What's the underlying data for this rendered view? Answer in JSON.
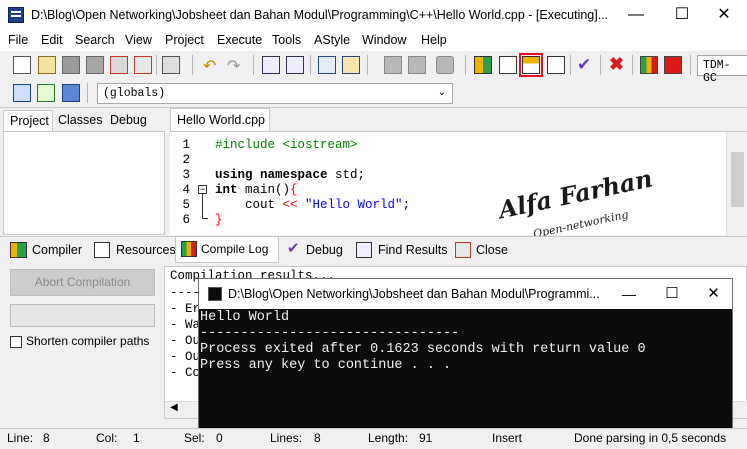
{
  "window": {
    "title": "D:\\Blog\\Open Networking\\Jobsheet dan Bahan Modul\\Programming\\C++\\Hello World.cpp - [Executing]...",
    "minimize_glyph": "—",
    "maximize_glyph": "☐",
    "close_glyph": "✕"
  },
  "menu": [
    "File",
    "Edit",
    "Search",
    "View",
    "Project",
    "Execute",
    "Tools",
    "AStyle",
    "Window",
    "Help"
  ],
  "toolbar": {
    "compiler_combo": "TDM-GC",
    "scope_combo": "(globals)"
  },
  "left_tabs": [
    "Project",
    "Classes",
    "Debug"
  ],
  "editor": {
    "tab": "Hello World.cpp",
    "line_numbers": [
      "1",
      "2",
      "3",
      "4",
      "5",
      "6"
    ],
    "lines": [
      {
        "parts": [
          {
            "t": "#include <iostream>",
            "c": "pp"
          }
        ]
      },
      {
        "parts": []
      },
      {
        "parts": [
          {
            "t": "using namespace",
            "c": "kw"
          },
          {
            "t": " std;",
            "c": ""
          }
        ]
      },
      {
        "parts": [
          {
            "t": "int",
            "c": "kw"
          },
          {
            "t": " main()",
            "c": ""
          },
          {
            "t": "{",
            "c": "br"
          }
        ]
      },
      {
        "parts": [
          {
            "t": "    cout ",
            "c": ""
          },
          {
            "t": "<<",
            "c": "op"
          },
          {
            "t": " ",
            "c": ""
          },
          {
            "t": "\"Hello World\"",
            "c": "str"
          },
          {
            "t": ";",
            "c": ""
          }
        ]
      },
      {
        "parts": [
          {
            "t": "}",
            "c": "br"
          }
        ]
      }
    ],
    "fold_marker": "−"
  },
  "watermark": {
    "line1": "Alfa Farhan",
    "line2": "Open-networking"
  },
  "bottom_tabs": [
    "Compiler",
    "Resources",
    "Compile Log",
    "Debug",
    "Find Results",
    "Close"
  ],
  "compile_panel": {
    "abort_button": "Abort Compilation",
    "shorten_label": "Shorten compiler paths",
    "log_header": "Compilation results...",
    "log_lines": [
      "----",
      "- Er",
      "- Wa",
      "- Ou",
      "- Ou",
      "- Co"
    ]
  },
  "console": {
    "title": "D:\\Blog\\Open Networking\\Jobsheet dan Bahan Modul\\Programmi...",
    "lines": [
      "Hello World",
      "--------------------------------",
      "Process exited after 0.1623 seconds with return value 0",
      "Press any key to continue . . ."
    ]
  },
  "statusbar": {
    "line_label": "Line:",
    "line_value": "8",
    "col_label": "Col:",
    "col_value": "1",
    "sel_label": "Sel:",
    "sel_value": "0",
    "lines_label": "Lines:",
    "lines_value": "8",
    "length_label": "Length:",
    "length_value": "91",
    "mode": "Insert",
    "parse": "Done parsing in 0,5 seconds"
  },
  "colors": {
    "highlight": "#e81123",
    "keyword": "#000000",
    "string": "#0000ff",
    "operator": "#ff0000",
    "preprocessor": "#008000"
  }
}
